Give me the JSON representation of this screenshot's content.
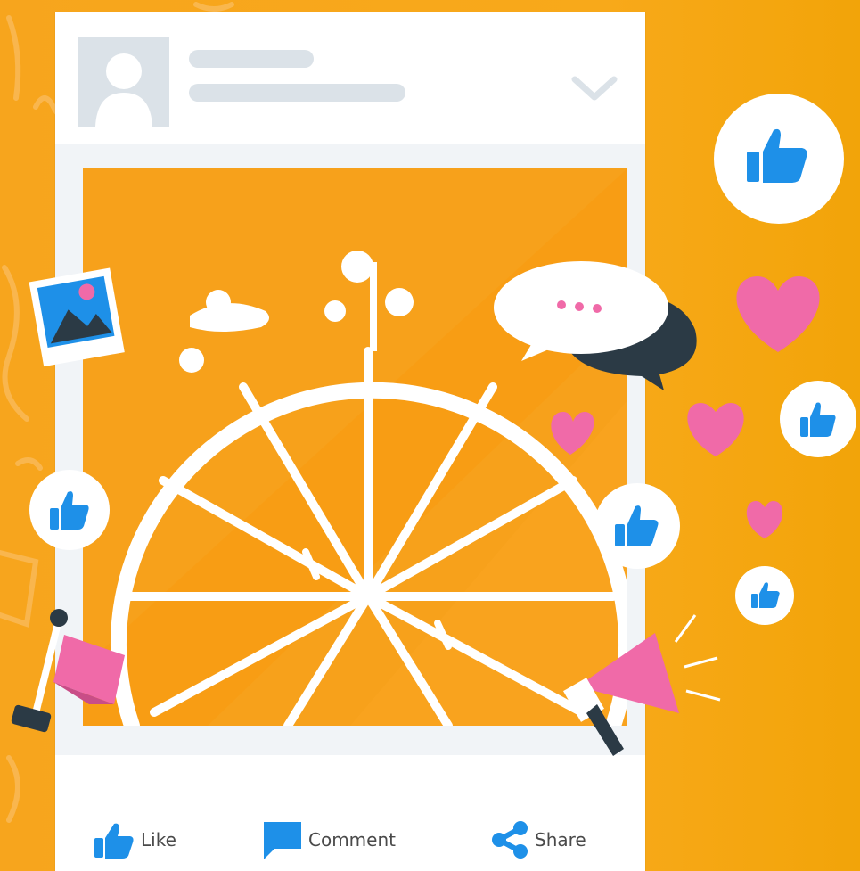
{
  "colors": {
    "background": "#f7a51d",
    "accent_blue": "#1e90e8",
    "heart_pink": "#f06aa8",
    "card": "#ffffff"
  },
  "post": {
    "actions": [
      {
        "label": "Like",
        "icon": "thumbs-up-icon"
      },
      {
        "label": "Comment",
        "icon": "comment-icon"
      },
      {
        "label": "Share",
        "icon": "share-icon"
      }
    ]
  },
  "floating_icons": [
    "thumbs-up-icon",
    "heart-icon",
    "speech-bubble-icon",
    "photo-icon",
    "megaphone-icon",
    "flag-icon"
  ]
}
